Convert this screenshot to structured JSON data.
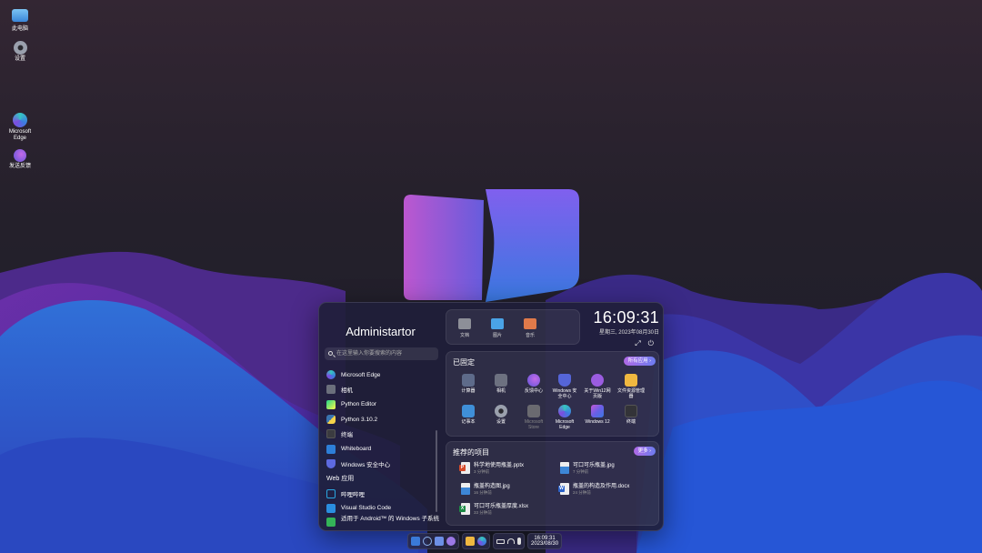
{
  "desktop": {
    "icons": [
      {
        "label": "此电脑",
        "icon": "monitor-icon",
        "color": "#5aa9e6"
      },
      {
        "label": "设置",
        "icon": "gear-icon",
        "color": "#8f95a3"
      },
      {
        "label": "Microsoft Edge",
        "icon": "edge-icon",
        "color": "#3d7be0"
      },
      {
        "label": "发送反馈",
        "icon": "feedback-icon",
        "color": "#9b59d6"
      }
    ]
  },
  "start": {
    "user_name": "Administartor",
    "search_placeholder": "在这里输入你要搜索的内容",
    "apps": [
      {
        "label": "Microsoft Edge",
        "icon": "edge-icon",
        "color": "#3d82e0"
      },
      {
        "label": "相机",
        "icon": "camera-icon",
        "color": "#6b6f7c"
      },
      {
        "label": "Python Editor",
        "icon": "pycharm-icon",
        "color": "#1ea84a"
      },
      {
        "label": "Python 3.10.2",
        "icon": "python-icon",
        "color": "#3a74b0"
      },
      {
        "label": "终端",
        "icon": "terminal-icon",
        "color": "#3b3b40"
      },
      {
        "label": "Whiteboard",
        "icon": "whiteboard-icon",
        "color": "#2d7fd8"
      },
      {
        "label": "Windows 安全中心",
        "icon": "shield-icon",
        "color": "#5d6ae0"
      },
      {
        "label": "Web 应用",
        "icon": "",
        "color": ""
      },
      {
        "label": "哔哩哔哩",
        "icon": "bilibili-icon",
        "color": "#2aa6e0"
      },
      {
        "label": "Visual Studio Code",
        "icon": "vscode-icon",
        "color": "#2a8ee0"
      },
      {
        "label": "适用于 Android™ 的 Windows 子系统",
        "icon": "android-icon",
        "color": "#34b358"
      }
    ],
    "quick": [
      {
        "label": "文档",
        "icon": "folder-docs-icon",
        "color": "#8d8f98"
      },
      {
        "label": "图片",
        "icon": "folder-pictures-icon",
        "color": "#4aa3e6"
      },
      {
        "label": "音乐",
        "icon": "folder-music-icon",
        "color": "#e07a4a"
      }
    ],
    "clock": {
      "time": "16:09:31",
      "date": "星期三, 2023年08月30日",
      "expand": "⤢",
      "power": "⏻"
    },
    "pinned": {
      "title": "已固定",
      "more": "所有应用 ›",
      "items": [
        {
          "label": "计算器",
          "icon": "calculator-icon",
          "color": "#5e6b8a"
        },
        {
          "label": "相机",
          "icon": "camera-icon",
          "color": "#6d7180"
        },
        {
          "label": "反馈中心",
          "icon": "feedback-icon",
          "color": "#8d6ae0"
        },
        {
          "label": "Windows 安全中心",
          "icon": "shield-icon",
          "color": "#5565d8"
        },
        {
          "label": "关于Win12网页版",
          "icon": "info-icon",
          "color": "#9a5ce0"
        },
        {
          "label": "文件资源管理器",
          "icon": "folder-icon",
          "color": "#f0b840"
        },
        {
          "label": "记事本",
          "icon": "notepad-icon",
          "color": "#3f8fd8"
        },
        {
          "label": "设置",
          "icon": "gear-icon",
          "color": "#8f95a3"
        },
        {
          "label": "Microsoft Store",
          "icon": "store-icon",
          "color": "#6a6a70"
        },
        {
          "label": "Microsoft Edge",
          "icon": "edge-icon",
          "color": "#3d82e0"
        },
        {
          "label": "Windows 12",
          "icon": "windows-icon",
          "color": "#7a5ce0"
        },
        {
          "label": "终端",
          "icon": "terminal-icon",
          "color": "#333338"
        }
      ]
    },
    "recommended": {
      "title": "推荐的项目",
      "more": "更多 ›",
      "items": [
        {
          "name": "科学地使用瓶盖.pptx",
          "sub": "3 分钟前",
          "badge": "P",
          "color": "#d44a2a"
        },
        {
          "name": "可口可乐瓶盖.jpg",
          "sub": "7 分钟前",
          "badge": "",
          "color": "#3d86d6"
        },
        {
          "name": "瓶盖构造图.jpg",
          "sub": "16 分钟前",
          "badge": "",
          "color": "#3d86d6"
        },
        {
          "name": "瓶盖的构造及作用.docx",
          "sub": "24 分钟前",
          "badge": "W",
          "color": "#2b62c8"
        },
        {
          "name": "可口可乐瓶盖厚度.xlsx",
          "sub": "33 分钟前",
          "badge": "X",
          "color": "#1e8a46"
        }
      ]
    }
  },
  "taskbar": {
    "icons": [
      {
        "name": "start-icon",
        "color": "#3a7ad8"
      },
      {
        "name": "search-icon",
        "color": "#8db4ef"
      },
      {
        "name": "widgets-icon",
        "color": "#6c8fe6"
      },
      {
        "name": "copilot-icon",
        "color": "#9b78e6"
      },
      {
        "name": "explorer-icon",
        "color": "#f0b840"
      },
      {
        "name": "edge-icon",
        "color": "#3d82e0"
      }
    ],
    "time": "16:09:31",
    "date": "2023/08/30"
  }
}
